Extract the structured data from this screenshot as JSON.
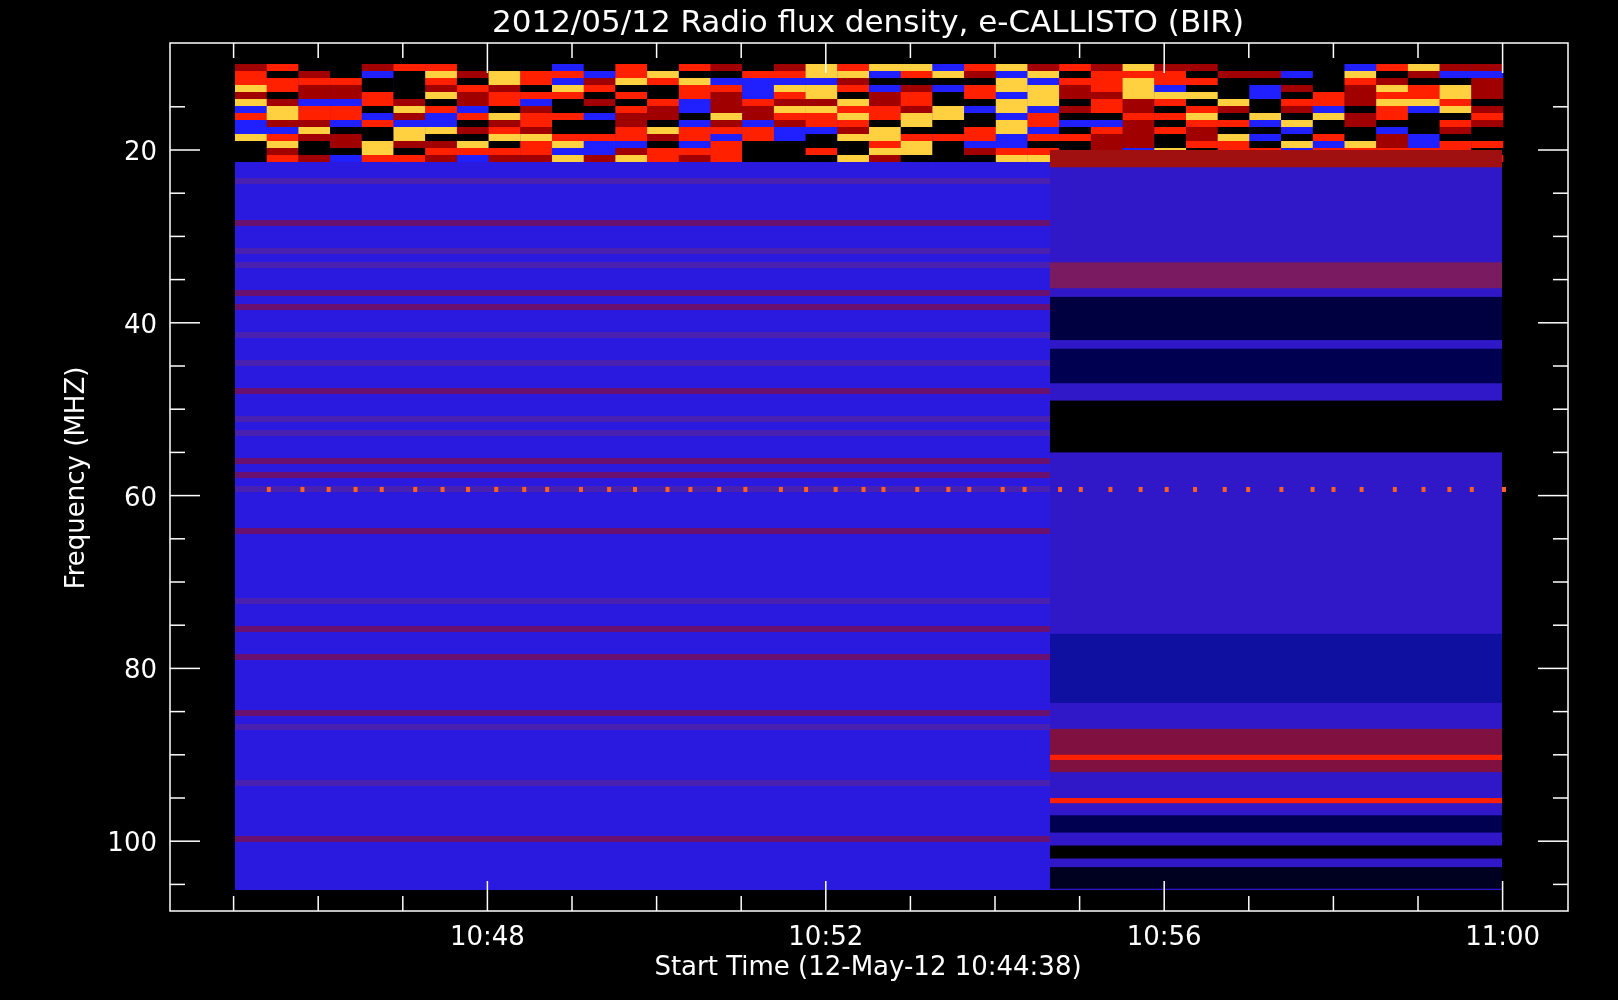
{
  "plot": {
    "title": "2012/05/12  Radio flux density, e-CALLISTO (BIR)",
    "xlabel": "Start Time (12-May-12 10:44:38)",
    "ylabel": "Frequency (MHZ)",
    "xticks": [
      "10:48",
      "10:52",
      "10:56",
      "11:00"
    ],
    "yticks": [
      "20",
      "40",
      "60",
      "80",
      "100"
    ]
  }
}
